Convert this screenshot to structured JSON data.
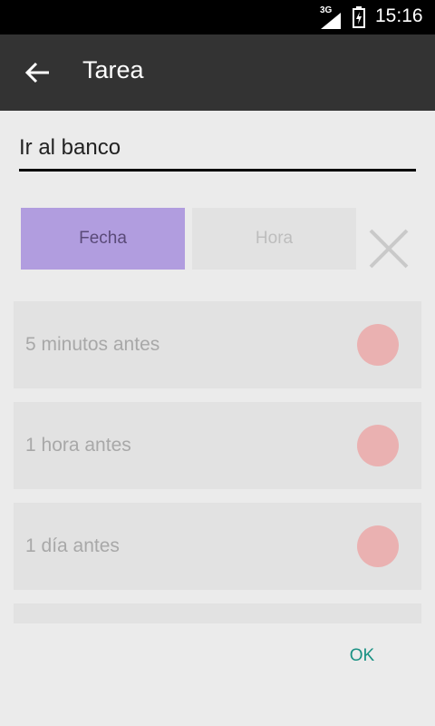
{
  "status_bar": {
    "network": "3G",
    "time": "15:16"
  },
  "app_bar": {
    "title": "Tarea"
  },
  "task": {
    "value": "Ir al banco"
  },
  "buttons": {
    "date": "Fecha",
    "time": "Hora"
  },
  "reminders": [
    {
      "label": "5 minutos antes"
    },
    {
      "label": "1 hora antes"
    },
    {
      "label": "1 día antes"
    }
  ],
  "actions": {
    "ok": "OK"
  },
  "colors": {
    "status_bar": "#000000",
    "app_bar": "#333333",
    "selected_button": "#b19ddf",
    "unselected_button": "#e2e2e2",
    "reminder_dot": "#eab1b1",
    "accent": "#199183"
  }
}
